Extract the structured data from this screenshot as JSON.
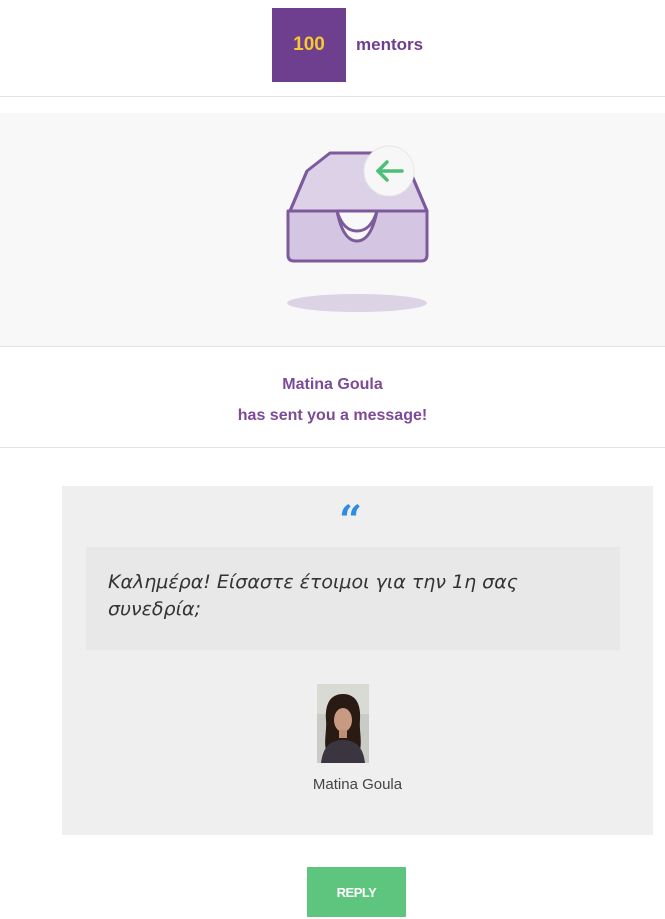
{
  "header": {
    "logo_number": "100",
    "logo_word": "mentors",
    "logo_color": "#6f3f8f",
    "logo_number_color": "#f7c82f"
  },
  "hero": {
    "illustration": "inbox-tray-icon",
    "badge_icon": "arrow-left-icon",
    "tray_color": "#d9cde6",
    "arrow_color": "#4cbf78"
  },
  "notice": {
    "sender_name": "Matina Goula",
    "text": "has sent you a message!",
    "color": "#7d4a98"
  },
  "message": {
    "quote_icon": "quote-icon",
    "quote_glyph": "“",
    "quote_color": "#2c8de2",
    "text": "Καλημέρα! Είσαστε έτοιμοι για την 1η σας συνεδρία;",
    "author_avatar": "avatar-photo",
    "author_name": "Matina Goula"
  },
  "actions": {
    "reply_label": "REPLY",
    "reply_color": "#5dc57e"
  }
}
